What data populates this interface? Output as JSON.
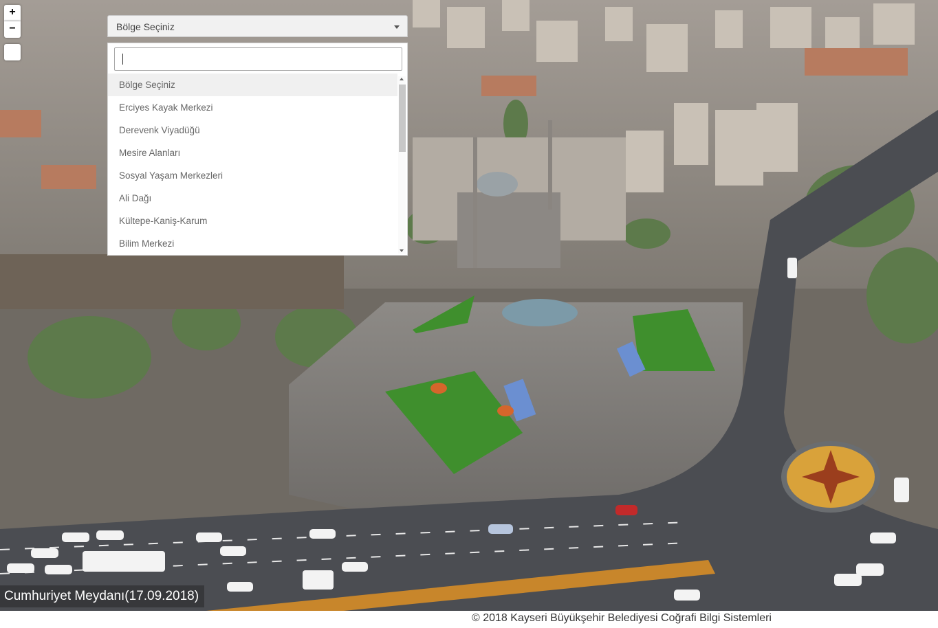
{
  "controls": {
    "zoom_in": "+",
    "zoom_out": "−"
  },
  "region_select": {
    "selected": "Bölge Seçiniz",
    "search_value": "",
    "options": [
      "Bölge Seçiniz",
      "Erciyes Kayak Merkezi",
      "Derevenk Viyadüğü",
      "Mesire Alanları",
      "Sosyal Yaşam Merkezleri",
      "Ali Dağı",
      "Kültepe-Kaniş-Karum",
      "Bilim Merkezi"
    ]
  },
  "panorama": {
    "caption": "Cumhuriyet Meydanı(17.09.2018)"
  },
  "footer": {
    "copyright": "© 2018 Kayseri Büyükşehir Belediyesi Coğrafi Bilgi Sistemleri"
  }
}
